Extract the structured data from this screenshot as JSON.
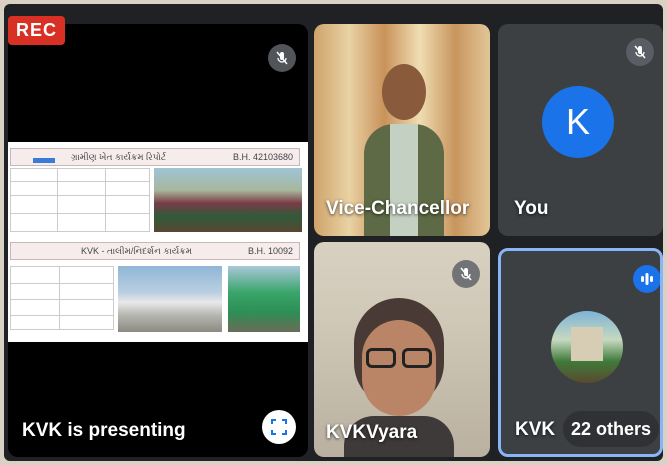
{
  "rec_badge": "REC",
  "presenter": {
    "label": "KVK is presenting",
    "doc": {
      "row1_title": "ગ્રામીણ ખેત કાર્યક્રમ રિપોર્ટ",
      "row1_code": "B.H. 42103680",
      "row2_title": "KVK - તાલીમ/નિદર્શન કાર્યક્રમ",
      "row2_code": "B.H. 10092"
    }
  },
  "tiles": {
    "vc": {
      "label": "Vice-Chancellor"
    },
    "you": {
      "label": "You",
      "avatar_letter": "K",
      "avatar_color": "#1a73e8"
    },
    "kvkvyara": {
      "label": "KVKVyara"
    },
    "others": {
      "label": "KVK",
      "count_label": "22 others",
      "active_border": "#8ab4f8"
    }
  },
  "icons": {
    "mic_off": "mic-off-icon",
    "fullscreen": "fullscreen-icon",
    "speaking": "speaking-indicator-icon"
  }
}
